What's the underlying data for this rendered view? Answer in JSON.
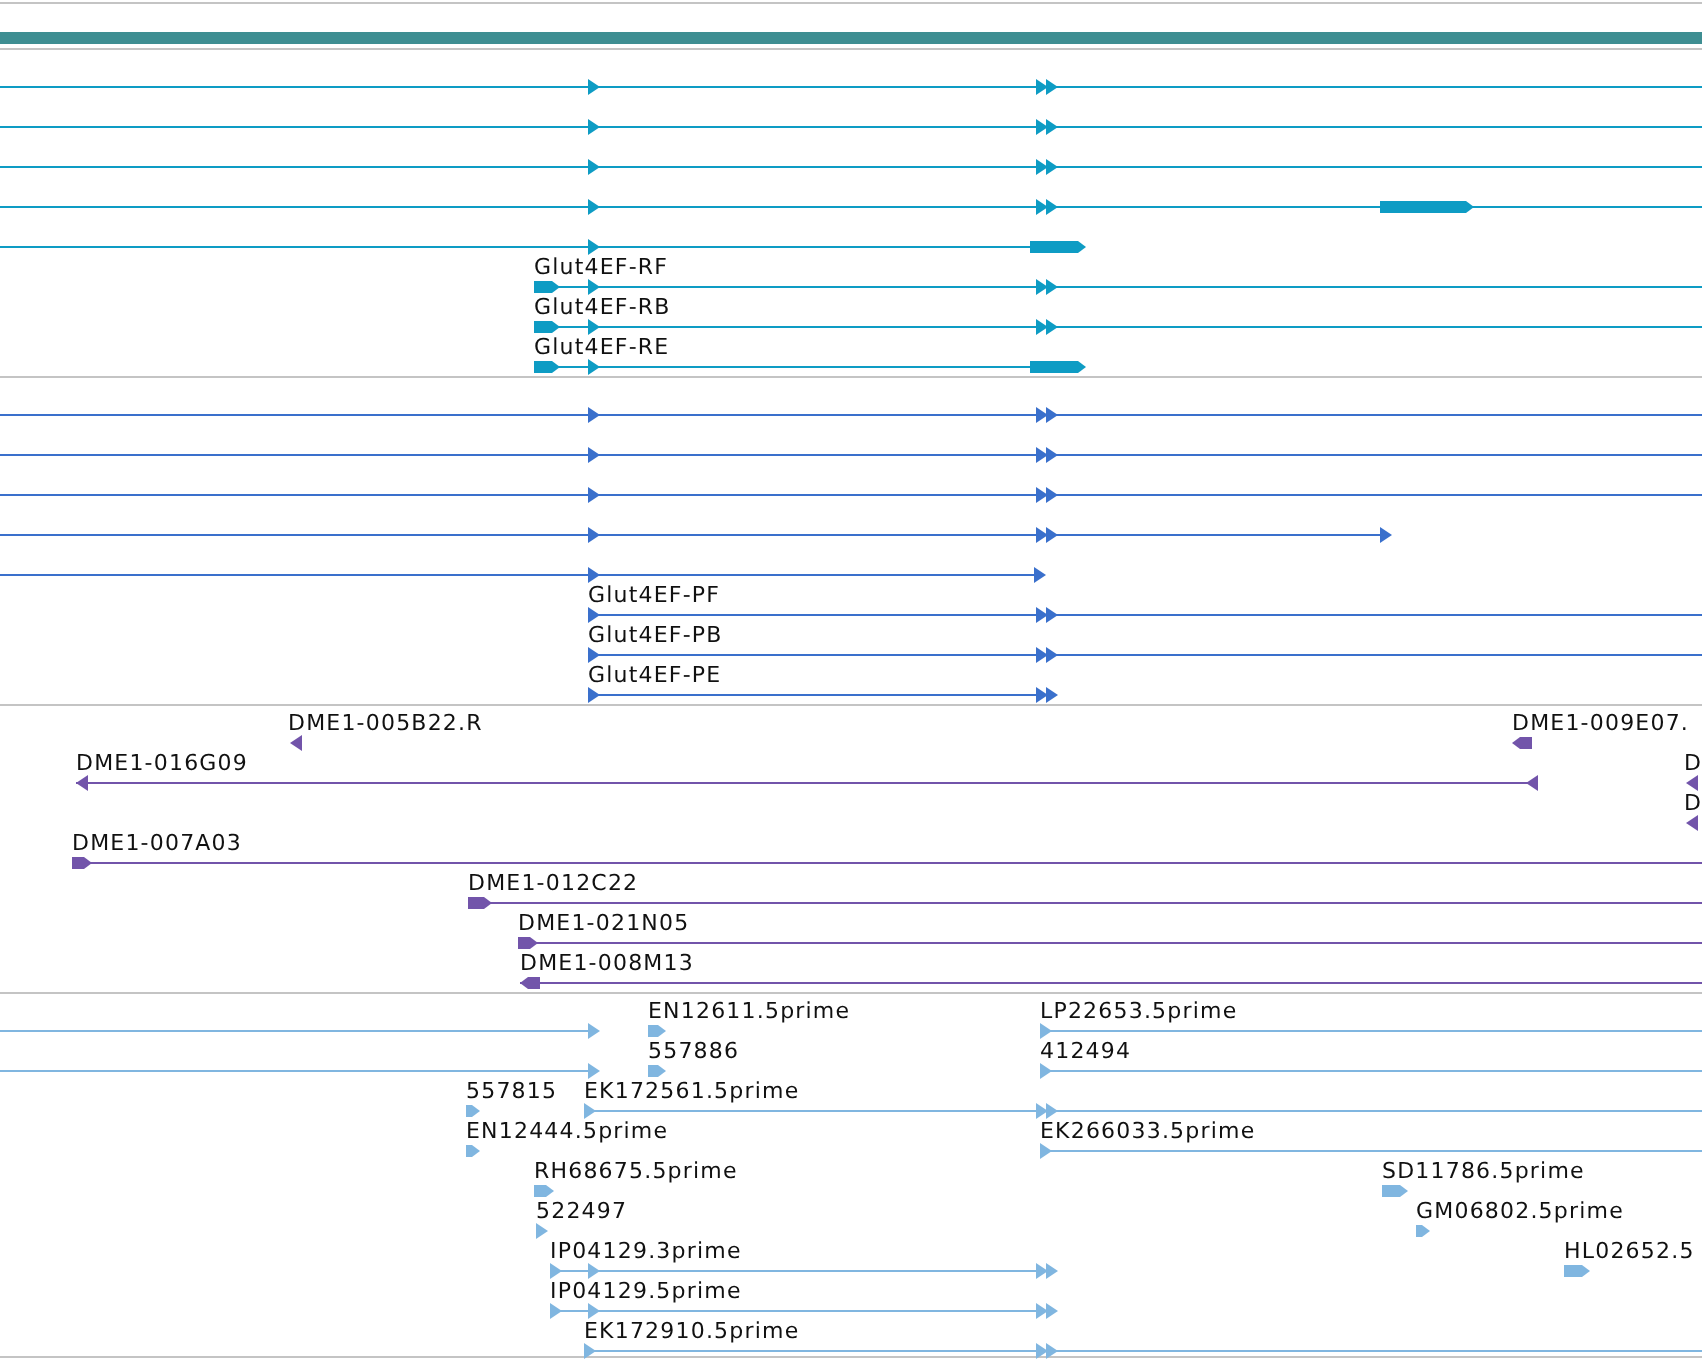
{
  "tracks": [
    {
      "color": "#0e9cc4",
      "features": [
        {
          "kind": "forward"
        },
        {
          "kind": "forward"
        },
        {
          "kind": "forward"
        },
        {
          "kind": "forward"
        },
        {
          "kind": "forward"
        },
        {
          "label": "Glut4EF-RF",
          "kind": "forward"
        },
        {
          "label": "Glut4EF-RB",
          "kind": "forward"
        },
        {
          "label": "Glut4EF-RE",
          "kind": "forward"
        }
      ]
    },
    {
      "color": "#3a70cc",
      "features": [
        {
          "kind": "forward"
        },
        {
          "kind": "forward"
        },
        {
          "kind": "forward"
        },
        {
          "kind": "forward"
        },
        {
          "kind": "forward"
        },
        {
          "label": "Glut4EF-PF",
          "kind": "forward"
        },
        {
          "label": "Glut4EF-PB",
          "kind": "forward"
        },
        {
          "label": "Glut4EF-PE",
          "kind": "forward"
        }
      ]
    },
    {
      "color": "#7254aa",
      "features": [
        {
          "label": "DME1-005B22.R",
          "kind": "reverse"
        },
        {
          "label": "DME1-009E07.",
          "kind": "reverse"
        },
        {
          "label": "DME1-016G09",
          "kind": "reverse"
        },
        {
          "label": "D",
          "kind": "reverse"
        },
        {
          "label": "D",
          "kind": "reverse"
        },
        {
          "label": "DME1-007A03",
          "kind": "forward"
        },
        {
          "label": "DME1-012C22",
          "kind": "forward"
        },
        {
          "label": "DME1-021N05",
          "kind": "forward"
        },
        {
          "label": "DME1-008M13",
          "kind": "reverse"
        }
      ]
    },
    {
      "color": "#80b6e0",
      "features": [
        {
          "kind": "forward"
        },
        {
          "label": "EN12611.5prime",
          "kind": "forward"
        },
        {
          "label": "LP22653.5prime",
          "kind": "forward"
        },
        {
          "kind": "forward"
        },
        {
          "label": "557886",
          "kind": "forward"
        },
        {
          "label": "412494",
          "kind": "forward"
        },
        {
          "label": "557815",
          "kind": "forward"
        },
        {
          "label": "EK172561.5prime",
          "kind": "forward"
        },
        {
          "label": "EN12444.5prime",
          "kind": "forward"
        },
        {
          "label": "EK266033.5prime",
          "kind": "forward"
        },
        {
          "label": "RH68675.5prime",
          "kind": "forward"
        },
        {
          "label": "SD11786.5prime",
          "kind": "forward"
        },
        {
          "label": "522497",
          "kind": "forward"
        },
        {
          "label": "GM06802.5prime",
          "kind": "forward"
        },
        {
          "label": "IP04129.3prime",
          "kind": "forward"
        },
        {
          "label": "HL02652.5",
          "kind": "forward"
        },
        {
          "label": "IP04129.5prime",
          "kind": "forward"
        },
        {
          "label": "EK172910.5prime",
          "kind": "forward"
        }
      ]
    }
  ]
}
